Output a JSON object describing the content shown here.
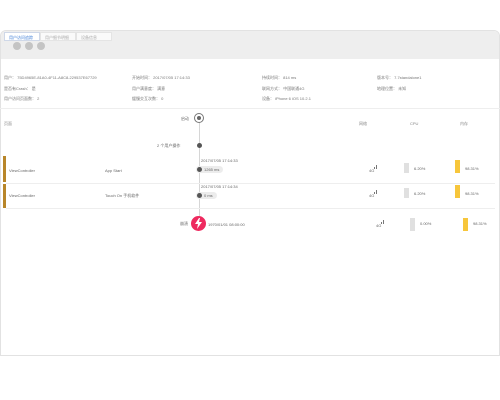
{
  "tabs": [
    {
      "label": "用户访问追踪",
      "active": true
    },
    {
      "label": "用户细节明细",
      "active": false
    },
    {
      "label": "设备信息",
      "active": false
    }
  ],
  "info": {
    "user": "用户：  75D4965E-81A0-4F11-A8C8-229537E67729",
    "start_time": "开始时间：  2017/07/05 17:14:33",
    "duration": "持续时间：  814 ms",
    "version": "版本号：  7.7standalone1",
    "is_crash": "是否有Crash：  是",
    "user_rating": "用户满意度：  满意",
    "network": "联网方式：  中国联通4G",
    "location": "地理位置：  未知",
    "page_view_count": "用户访问页面数：  2",
    "slow_interaction_count": "缓慢交互次数：  0",
    "device": "设备：  iPhone 6   iOS 10.2.1"
  },
  "columns": {
    "page": "页面",
    "network": "网络",
    "cpu": "CPU",
    "memory": "内存"
  },
  "timeline": {
    "launch_label": "启动",
    "group_label": "2 个用户操作",
    "crash_label": "崩溃",
    "crash_time": "1970/01/01 08:00:00"
  },
  "rows": [
    {
      "page": "ViewController",
      "action": "App Start",
      "time": "2017/07/05 17:14:33",
      "duration": "1265 ms",
      "network": "4G",
      "cpu": "6.20%",
      "memory": "98.31%"
    },
    {
      "page": "ViewController",
      "action": "Touch On 手机软件",
      "time": "2017/07/05 17:14:34",
      "duration": "0 ms",
      "network": "4G",
      "cpu": "6.20%",
      "memory": "98.31%"
    }
  ],
  "crash_row": {
    "network": "4G",
    "cpu": "0.00%",
    "memory": "98.31%"
  },
  "colors": {
    "accent": "#3a7bd5",
    "row_marker": "#b8862a",
    "crash": "#ee2a5f",
    "memory_bar": "#f7c63b",
    "cpu_bar": "#e0e0e0"
  },
  "icons": [
    "launch-icon",
    "crash-bolt-icon",
    "signal-icon",
    "clock-icon"
  ]
}
